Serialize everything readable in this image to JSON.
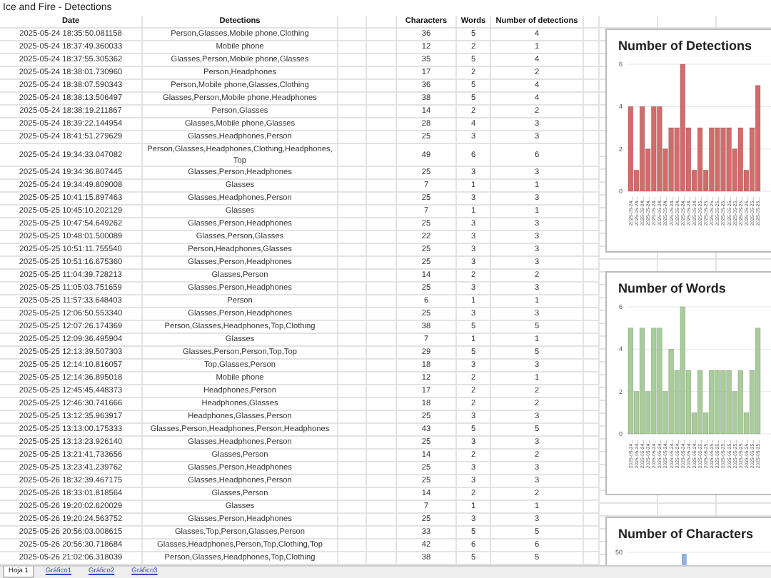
{
  "title": "Ice and Fire - Detections",
  "table": {
    "columns": [
      "Date",
      "Detections",
      "Characters",
      "Words",
      "Number of detections"
    ],
    "rows": [
      {
        "date": "2025-05-24 18:35:50.081158",
        "detections": "Person,Glasses,Mobile phone,Clothing",
        "characters": "36",
        "words": "5",
        "count": "4"
      },
      {
        "date": "2025-05-24 18:37:49.360033",
        "detections": "Mobile phone",
        "characters": "12",
        "words": "2",
        "count": "1"
      },
      {
        "date": "2025-05-24 18:37:55.305362",
        "detections": "Glasses,Person,Mobile phone,Glasses",
        "characters": "35",
        "words": "5",
        "count": "4"
      },
      {
        "date": "2025-05-24 18:38:01.730960",
        "detections": "Person,Headphones",
        "characters": "17",
        "words": "2",
        "count": "2"
      },
      {
        "date": "2025-05-24 18:38:07.590343",
        "detections": "Person,Mobile phone,Glasses,Clothing",
        "characters": "36",
        "words": "5",
        "count": "4"
      },
      {
        "date": "2025-05-24 18:38:13.506497",
        "detections": "Glasses,Person,Mobile phone,Headphones",
        "characters": "38",
        "words": "5",
        "count": "4"
      },
      {
        "date": "2025-05-24 18:38:19.211867",
        "detections": "Person,Glasses",
        "characters": "14",
        "words": "2",
        "count": "2"
      },
      {
        "date": "2025-05-24 18:39:22.144954",
        "detections": "Glasses,Mobile phone,Glasses",
        "characters": "28",
        "words": "4",
        "count": "3"
      },
      {
        "date": "2025-05-24 18:41:51.279629",
        "detections": "Glasses,Headphones,Person",
        "characters": "25",
        "words": "3",
        "count": "3"
      },
      {
        "date": "2025-05-24 19:34:33.047082",
        "detections": "Person,Glasses,Headphones,Clothing,Headphones,Top",
        "characters": "49",
        "words": "6",
        "count": "6"
      },
      {
        "date": "2025-05-24 19:34:36.807445",
        "detections": "Glasses,Person,Headphones",
        "characters": "25",
        "words": "3",
        "count": "3"
      },
      {
        "date": "2025-05-24 19:34:49.809008",
        "detections": "Glasses",
        "characters": "7",
        "words": "1",
        "count": "1"
      },
      {
        "date": "2025-05-25 10:41:15.897463",
        "detections": "Glasses,Headphones,Person",
        "characters": "25",
        "words": "3",
        "count": "3"
      },
      {
        "date": "2025-05-25 10:45:10.202129",
        "detections": "Glasses",
        "characters": "7",
        "words": "1",
        "count": "1"
      },
      {
        "date": "2025-05-25 10:47:54.649262",
        "detections": "Glasses,Person,Headphones",
        "characters": "25",
        "words": "3",
        "count": "3"
      },
      {
        "date": "2025-05-25 10:48:01.500089",
        "detections": "Glasses,Person,Glasses",
        "characters": "22",
        "words": "3",
        "count": "3"
      },
      {
        "date": "2025-05-25 10:51:11.755540",
        "detections": "Person,Headphones,Glasses",
        "characters": "25",
        "words": "3",
        "count": "3"
      },
      {
        "date": "2025-05-25 10:51:16.675360",
        "detections": "Glasses,Person,Headphones",
        "characters": "25",
        "words": "3",
        "count": "3"
      },
      {
        "date": "2025-05-25 11:04:39.728213",
        "detections": "Glasses,Person",
        "characters": "14",
        "words": "2",
        "count": "2"
      },
      {
        "date": "2025-05-25 11:05:03.751659",
        "detections": "Glasses,Person,Headphones",
        "characters": "25",
        "words": "3",
        "count": "3"
      },
      {
        "date": "2025-05-25 11:57:33.648403",
        "detections": "Person",
        "characters": "6",
        "words": "1",
        "count": "1"
      },
      {
        "date": "2025-05-25 12:06:50.553340",
        "detections": "Glasses,Person,Headphones",
        "characters": "25",
        "words": "3",
        "count": "3"
      },
      {
        "date": "2025-05-25 12:07:26.174369",
        "detections": "Person,Glasses,Headphones,Top,Clothing",
        "characters": "38",
        "words": "5",
        "count": "5"
      },
      {
        "date": "2025-05-25 12:09:36.495904",
        "detections": "Glasses",
        "characters": "7",
        "words": "1",
        "count": "1"
      },
      {
        "date": "2025-05-25 12:13:39.507303",
        "detections": "Glasses,Person,Person,Top,Top",
        "characters": "29",
        "words": "5",
        "count": "5"
      },
      {
        "date": "2025-05-25 12:14:10.816057",
        "detections": "Top,Glasses,Person",
        "characters": "18",
        "words": "3",
        "count": "3"
      },
      {
        "date": "2025-05-25 12:14:36.895018",
        "detections": "Mobile phone",
        "characters": "12",
        "words": "2",
        "count": "1"
      },
      {
        "date": "2025-05-25 12:45:45.448373",
        "detections": "Headphones,Person",
        "characters": "17",
        "words": "2",
        "count": "2"
      },
      {
        "date": "2025-05-25 12:46:30.741666",
        "detections": "Headphones,Glasses",
        "characters": "18",
        "words": "2",
        "count": "2"
      },
      {
        "date": "2025-05-25 13:12:35.963917",
        "detections": "Headphones,Glasses,Person",
        "characters": "25",
        "words": "3",
        "count": "3"
      },
      {
        "date": "2025-05-25 13:13:00.175333",
        "detections": "Glasses,Person,Headphones,Person,Headphones",
        "characters": "43",
        "words": "5",
        "count": "5"
      },
      {
        "date": "2025-05-25 13:13:23.926140",
        "detections": "Glasses,Headphones,Person",
        "characters": "25",
        "words": "3",
        "count": "3"
      },
      {
        "date": "2025-05-25 13:21:41.733656",
        "detections": "Glasses,Person",
        "characters": "14",
        "words": "2",
        "count": "2"
      },
      {
        "date": "2025-05-25 13:23:41.239762",
        "detections": "Glasses,Person,Headphones",
        "characters": "25",
        "words": "3",
        "count": "3"
      },
      {
        "date": "2025-05-26 18:32:39.467175",
        "detections": "Glasses,Headphones,Person",
        "characters": "25",
        "words": "3",
        "count": "3"
      },
      {
        "date": "2025-05-26 18:33:01.818564",
        "detections": "Glasses,Person",
        "characters": "14",
        "words": "2",
        "count": "2"
      },
      {
        "date": "2025-05-26 19:20:02.620029",
        "detections": "Glasses",
        "characters": "7",
        "words": "1",
        "count": "1"
      },
      {
        "date": "2025-05-26 19:20:24.563752",
        "detections": "Glasses,Person,Headphones",
        "characters": "25",
        "words": "3",
        "count": "3"
      },
      {
        "date": "2025-05-26 20:56:03.008615",
        "detections": "Glasses,Top,Person,Glasses,Person",
        "characters": "33",
        "words": "5",
        "count": "5"
      },
      {
        "date": "2025-05-26 20:56:30.718684",
        "detections": "Glasses,Headphones,Person,Top,Clothing,Top",
        "characters": "42",
        "words": "6",
        "count": "6"
      },
      {
        "date": "2025-05-26 21:02:06.318039",
        "detections": "Person,Glasses,Headphones,Top,Clothing",
        "characters": "38",
        "words": "5",
        "count": "5"
      }
    ]
  },
  "charts": [
    {
      "chart_data": {
        "type": "bar",
        "title": "Number of Detections",
        "yticks": [
          0,
          2,
          4,
          6
        ],
        "ylim": [
          0,
          6
        ],
        "categories": [
          "2025-05-24...",
          "2025-05-24...",
          "2025-05-24...",
          "2025-05-24...",
          "2025-05-24...",
          "2025-05-24...",
          "2025-05-24...",
          "2025-05-24...",
          "2025-05-24...",
          "2025-05-24...",
          "2025-05-24...",
          "2025-05-24...",
          "2025-05-25...",
          "2025-05-25...",
          "2025-05-25...",
          "2025-05-25...",
          "2025-05-25...",
          "2025-05-25...",
          "2025-05-25...",
          "2025-05-25...",
          "2025-05-25...",
          "2025-05-25...",
          "2025-05-25..."
        ],
        "series": [
          {
            "color": "#d46b6b",
            "values": [
              4,
              1,
              4,
              2,
              4,
              4,
              2,
              3,
              3,
              6,
              3,
              1,
              3,
              1,
              3,
              3,
              3,
              3,
              2,
              3,
              1,
              3,
              5
            ]
          }
        ]
      }
    },
    {
      "chart_data": {
        "type": "bar",
        "title": "Number of Words",
        "yticks": [
          0,
          2,
          4,
          6
        ],
        "ylim": [
          0,
          6
        ],
        "categories": [
          "2025-05-24...",
          "2025-05-24...",
          "2025-05-24...",
          "2025-05-24...",
          "2025-05-24...",
          "2025-05-24...",
          "2025-05-24...",
          "2025-05-24...",
          "2025-05-24...",
          "2025-05-24...",
          "2025-05-24...",
          "2025-05-24...",
          "2025-05-25...",
          "2025-05-25...",
          "2025-05-25...",
          "2025-05-25...",
          "2025-05-25...",
          "2025-05-25...",
          "2025-05-25...",
          "2025-05-25...",
          "2025-05-25...",
          "2025-05-25...",
          "2025-05-25..."
        ],
        "series": [
          {
            "color": "#a8cd9a",
            "values": [
              5,
              2,
              5,
              2,
              5,
              5,
              2,
              4,
              3,
              6,
              3,
              1,
              3,
              1,
              3,
              3,
              3,
              3,
              2,
              3,
              1,
              3,
              5
            ]
          }
        ]
      }
    },
    {
      "title": "Number of Characters",
      "tick_label": "50"
    }
  ],
  "sheet_tabs": [
    {
      "label": "Hoja 1",
      "selected": true
    },
    {
      "label": "Gráfico1",
      "selected": false
    },
    {
      "label": "Gráfico2",
      "selected": false
    },
    {
      "label": "Gráfico3",
      "selected": false
    }
  ]
}
